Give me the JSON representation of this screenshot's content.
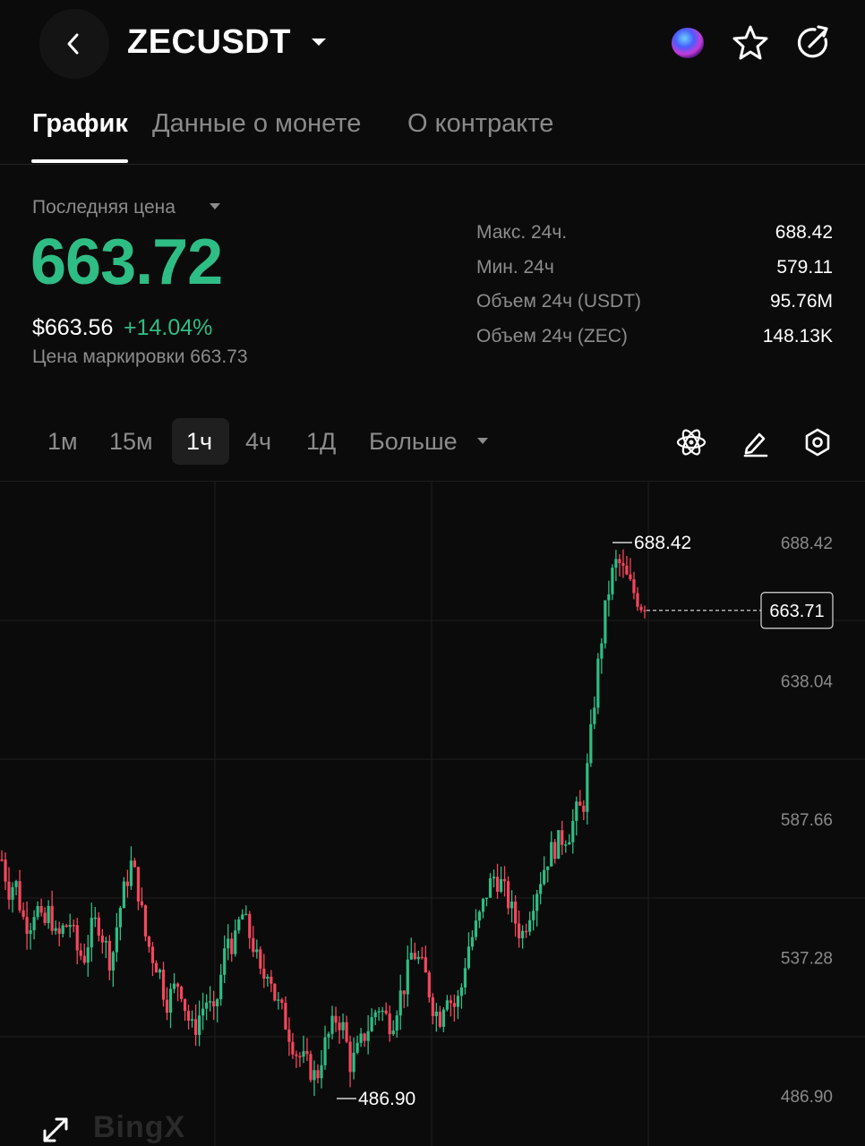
{
  "header": {
    "symbol": "ZECUSDT",
    "icons": [
      "back-arrow-icon",
      "caret-down-icon",
      "ai-orb-icon",
      "star-icon",
      "share-icon"
    ]
  },
  "tabs": [
    {
      "label": "График",
      "active": true
    },
    {
      "label": "Данные о монете",
      "active": false
    },
    {
      "label": "О контракте",
      "active": false
    }
  ],
  "price": {
    "label": "Последняя цена",
    "last": "663.72",
    "usd": "$663.56",
    "change_pct": "+14.04%",
    "mark_price": "Цена маркировки 663.73",
    "color_up": "#2ebd85"
  },
  "stats": [
    {
      "label": "Макс. 24ч.",
      "value": "688.42"
    },
    {
      "label": "Мин. 24ч",
      "value": "579.11"
    },
    {
      "label": "Объем 24ч (USDT)",
      "value": "95.76M"
    },
    {
      "label": "Объем 24ч (ZEC)",
      "value": "148.13K"
    }
  ],
  "timeframes": [
    {
      "label": "1м",
      "active": false
    },
    {
      "label": "15м",
      "active": false
    },
    {
      "label": "1ч",
      "active": true
    },
    {
      "label": "4ч",
      "active": false
    },
    {
      "label": "1Д",
      "active": false
    },
    {
      "label": "Больше",
      "active": false
    }
  ],
  "tools": [
    "indicators-atom-icon",
    "draw-pen-icon",
    "settings-hexagon-icon"
  ],
  "watermark": "BingX",
  "chart_data": {
    "type": "candlestick",
    "interval": "1h",
    "y_axis_ticks": [
      "688.42",
      "638.04",
      "587.66",
      "537.28",
      "486.90"
    ],
    "ylim": [
      486.9,
      688.42
    ],
    "current_price_label": "663.71",
    "high_label": "688.42",
    "low_label": "486.90",
    "grid": true,
    "colors": {
      "up": "#2ebd85",
      "down": "#f6465d"
    },
    "close_path": [
      573,
      562,
      565,
      552,
      549,
      557,
      547,
      555,
      543,
      548,
      550,
      540,
      537,
      547,
      551,
      543,
      535,
      552,
      563,
      572,
      561,
      545,
      538,
      533,
      521,
      525,
      529,
      517,
      510,
      517,
      522,
      515,
      530,
      545,
      541,
      554,
      547,
      540,
      528,
      535,
      522,
      517,
      510,
      503,
      500,
      497,
      493,
      504,
      510,
      516,
      511,
      498,
      503,
      509,
      514,
      520,
      516,
      513,
      522,
      528,
      540,
      536,
      530,
      520,
      515,
      526,
      519,
      523,
      540,
      546,
      553,
      562,
      567,
      564,
      558,
      551,
      545,
      553,
      561,
      568,
      575,
      578,
      581,
      583,
      590,
      592,
      615,
      640,
      660,
      675,
      682,
      677,
      672,
      668,
      664
    ]
  }
}
